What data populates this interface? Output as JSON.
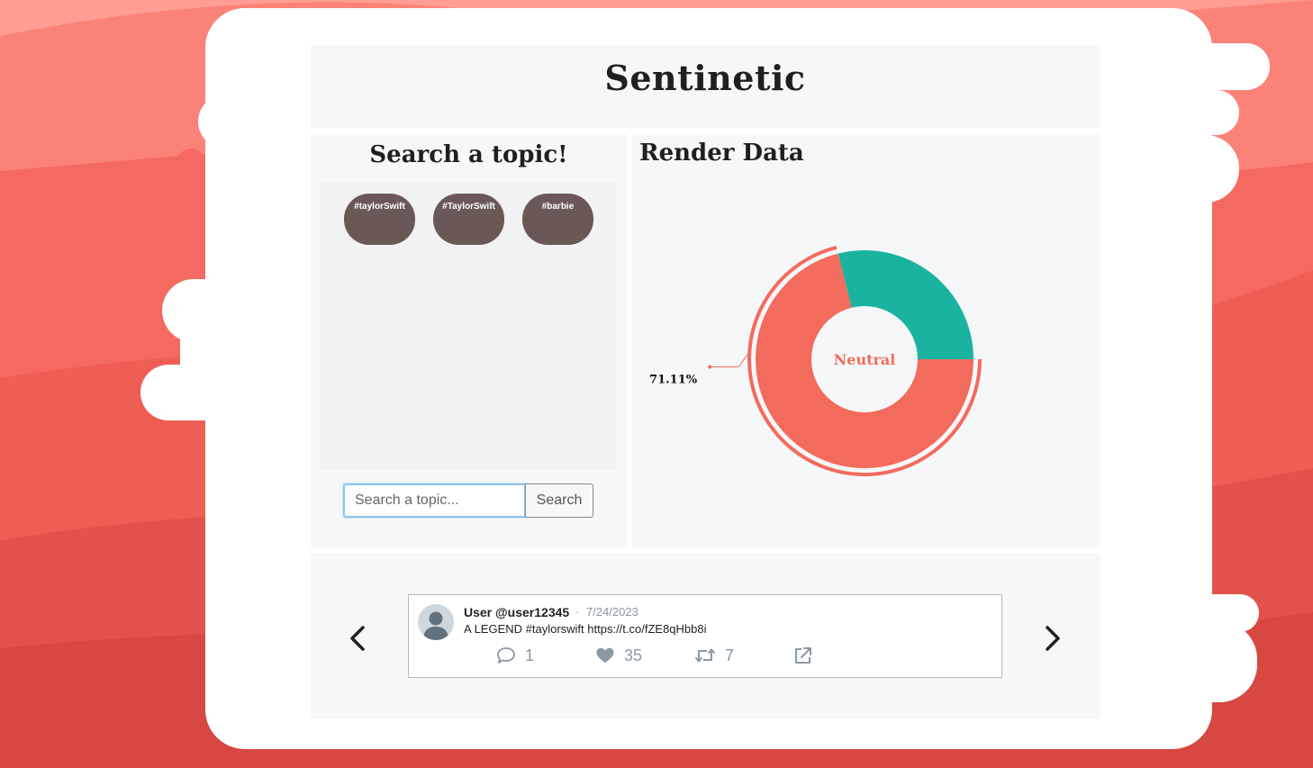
{
  "app": {
    "title": "Sentinetic",
    "colors": {
      "background": "#e9574d",
      "card": "#ffffff",
      "panel": "#f6f7f8",
      "chip": "#6a5857",
      "positive": "#1ab39f",
      "neutral": "#f36b5d"
    }
  },
  "search": {
    "heading": "Search a topic!",
    "topics": [
      "#taylorSwift",
      "#TaylorSwift",
      "#barbie"
    ],
    "input_placeholder": "Search a topic...",
    "input_value": "",
    "button_label": "Search"
  },
  "render": {
    "heading": "Render Data"
  },
  "chart_data": {
    "type": "pie",
    "variant": "donut",
    "center_label": "Neutral",
    "highlighted_slice": 0,
    "slices": [
      {
        "label": "Neutral",
        "value": 71.11,
        "color": "#f36b5d"
      },
      {
        "label": "",
        "value": 28.89,
        "color": "#1ab39f"
      }
    ],
    "annotation": "71.11%"
  },
  "tweet": {
    "user": "User @user12345",
    "separator": "·",
    "date": "7/24/2023",
    "text": "A LEGEND #taylorswift https://t.co/fZE8qHbb8i",
    "replies": "1",
    "likes": "35",
    "retweets": "7",
    "icons": [
      "reply-icon",
      "heart-icon",
      "retweet-icon",
      "share-icon"
    ]
  },
  "carousel": {
    "prev_icon": "chevron-left-icon",
    "next_icon": "chevron-right-icon"
  }
}
